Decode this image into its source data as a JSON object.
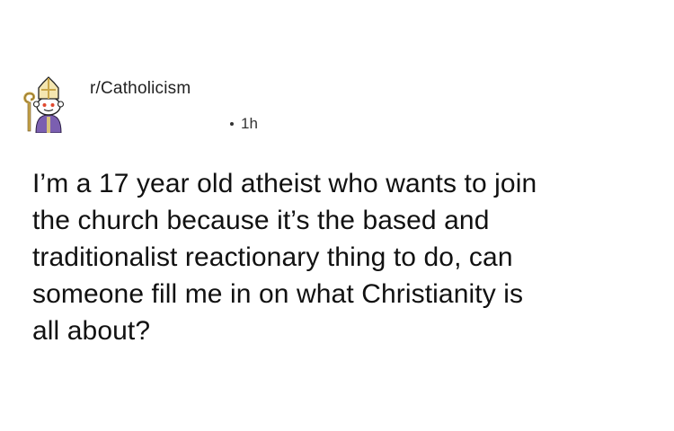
{
  "post": {
    "subreddit": "r/Catholicism",
    "time": "1h",
    "body_lines": [
      "I’m a 17 year old atheist who wants to join",
      "the church because it’s the based and",
      "traditionalist reactionary thing to do, can",
      "someone fill me in on what Christianity is",
      "all about?"
    ]
  },
  "avatar": {
    "icon": "bishop-mitre-snoo-icon"
  },
  "colors": {
    "background": "#ffffff",
    "text": "#111111",
    "mitre": "#f4e6b0",
    "robe": "#7b5fb0"
  }
}
